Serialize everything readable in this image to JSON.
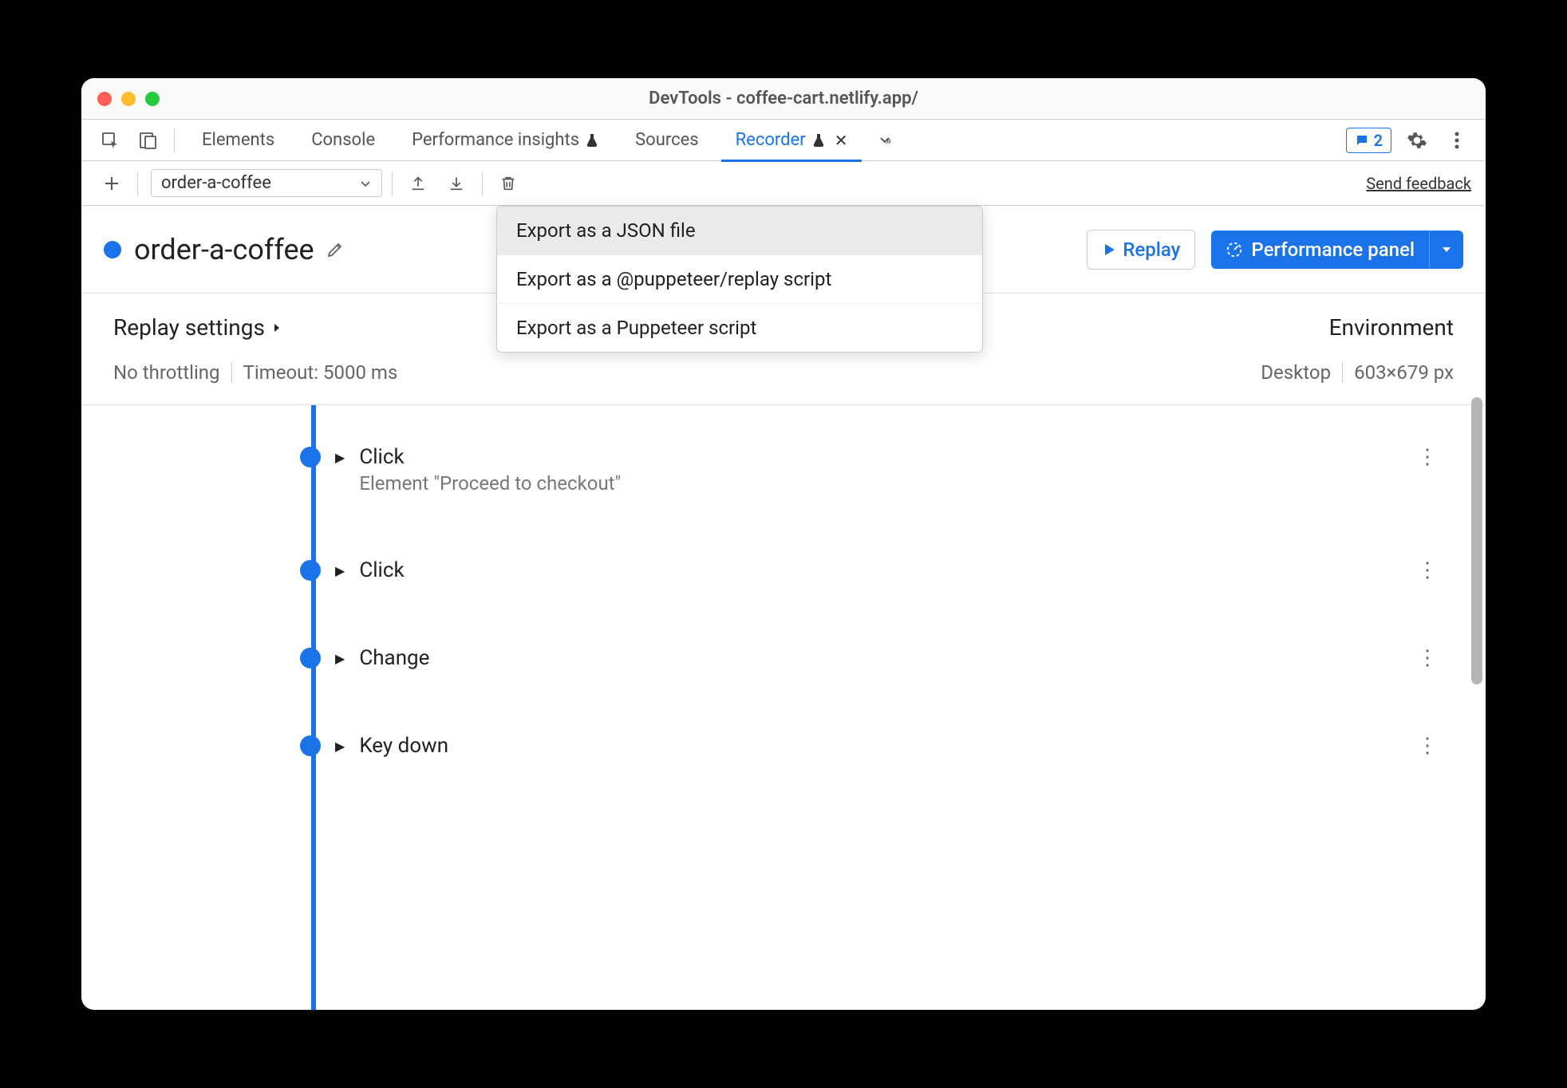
{
  "window": {
    "title": "DevTools - coffee-cart.netlify.app/"
  },
  "tabs": {
    "items": [
      {
        "label": "Elements",
        "flask": false,
        "closeable": false,
        "active": false
      },
      {
        "label": "Console",
        "flask": false,
        "closeable": false,
        "active": false
      },
      {
        "label": "Performance insights",
        "flask": true,
        "closeable": false,
        "active": false
      },
      {
        "label": "Sources",
        "flask": false,
        "closeable": false,
        "active": false
      },
      {
        "label": "Recorder",
        "flask": true,
        "closeable": true,
        "active": true
      }
    ],
    "messages_badge": "2"
  },
  "toolbar": {
    "recording_name": "order-a-coffee",
    "feedback_label": "Send feedback"
  },
  "export_menu": {
    "items": [
      "Export as a JSON file",
      "Export as a @puppeteer/replay script",
      "Export as a Puppeteer script"
    ],
    "highlighted_index": 0
  },
  "header": {
    "title": "order-a-coffee",
    "replay_label": "Replay",
    "perf_label": "Performance panel"
  },
  "settings": {
    "left_title": "Replay settings",
    "throttle": "No throttling",
    "timeout": "Timeout: 5000 ms",
    "right_title": "Environment",
    "device": "Desktop",
    "dimensions": "603×679 px"
  },
  "steps": [
    {
      "label": "Click",
      "detail": "Element \"Proceed to checkout\""
    },
    {
      "label": "Click",
      "detail": ""
    },
    {
      "label": "Change",
      "detail": ""
    },
    {
      "label": "Key down",
      "detail": ""
    }
  ]
}
